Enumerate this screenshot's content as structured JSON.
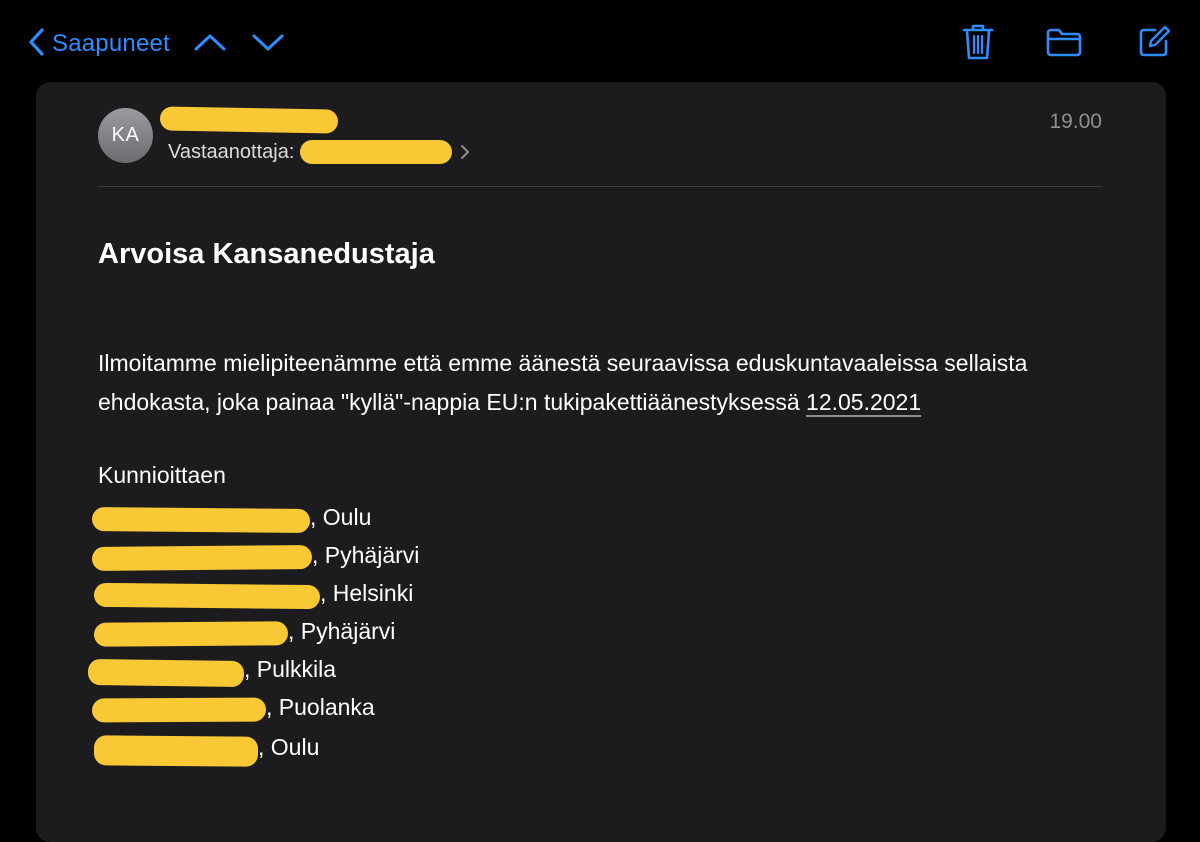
{
  "toolbar": {
    "back_label": "Saapuneet",
    "icons": [
      "chevron-left-icon",
      "chevron-up-icon",
      "chevron-down-icon",
      "trash-icon",
      "folder-icon",
      "compose-icon"
    ],
    "accent_color": "#2f8cff"
  },
  "message": {
    "avatar_initials": "KA",
    "recipient_label": "Vastaanottaja:",
    "time": "19.00",
    "greeting": "Arvoisa Kansanedustaja",
    "body_part1": "Ilmoitamme mielipiteenämme että emme äänestä seuraavissa eduskuntavaaleissa sellaista ehdokasta, joka painaa \"kyllä\"-nappia EU:n tukipakettiäänestyksessä ",
    "body_date": "12.05.2021",
    "closing": "Kunnioittaen",
    "signatures": [
      {
        "place": ", Oulu"
      },
      {
        "place": ", Pyhäjärvi"
      },
      {
        "place": ", Helsinki"
      },
      {
        "place": ", Pyhäjärvi"
      },
      {
        "place": ", Pulkkila"
      },
      {
        "place": ", Puolanka"
      },
      {
        "place": ", Oulu"
      }
    ],
    "redaction_color": "#f9c935"
  }
}
